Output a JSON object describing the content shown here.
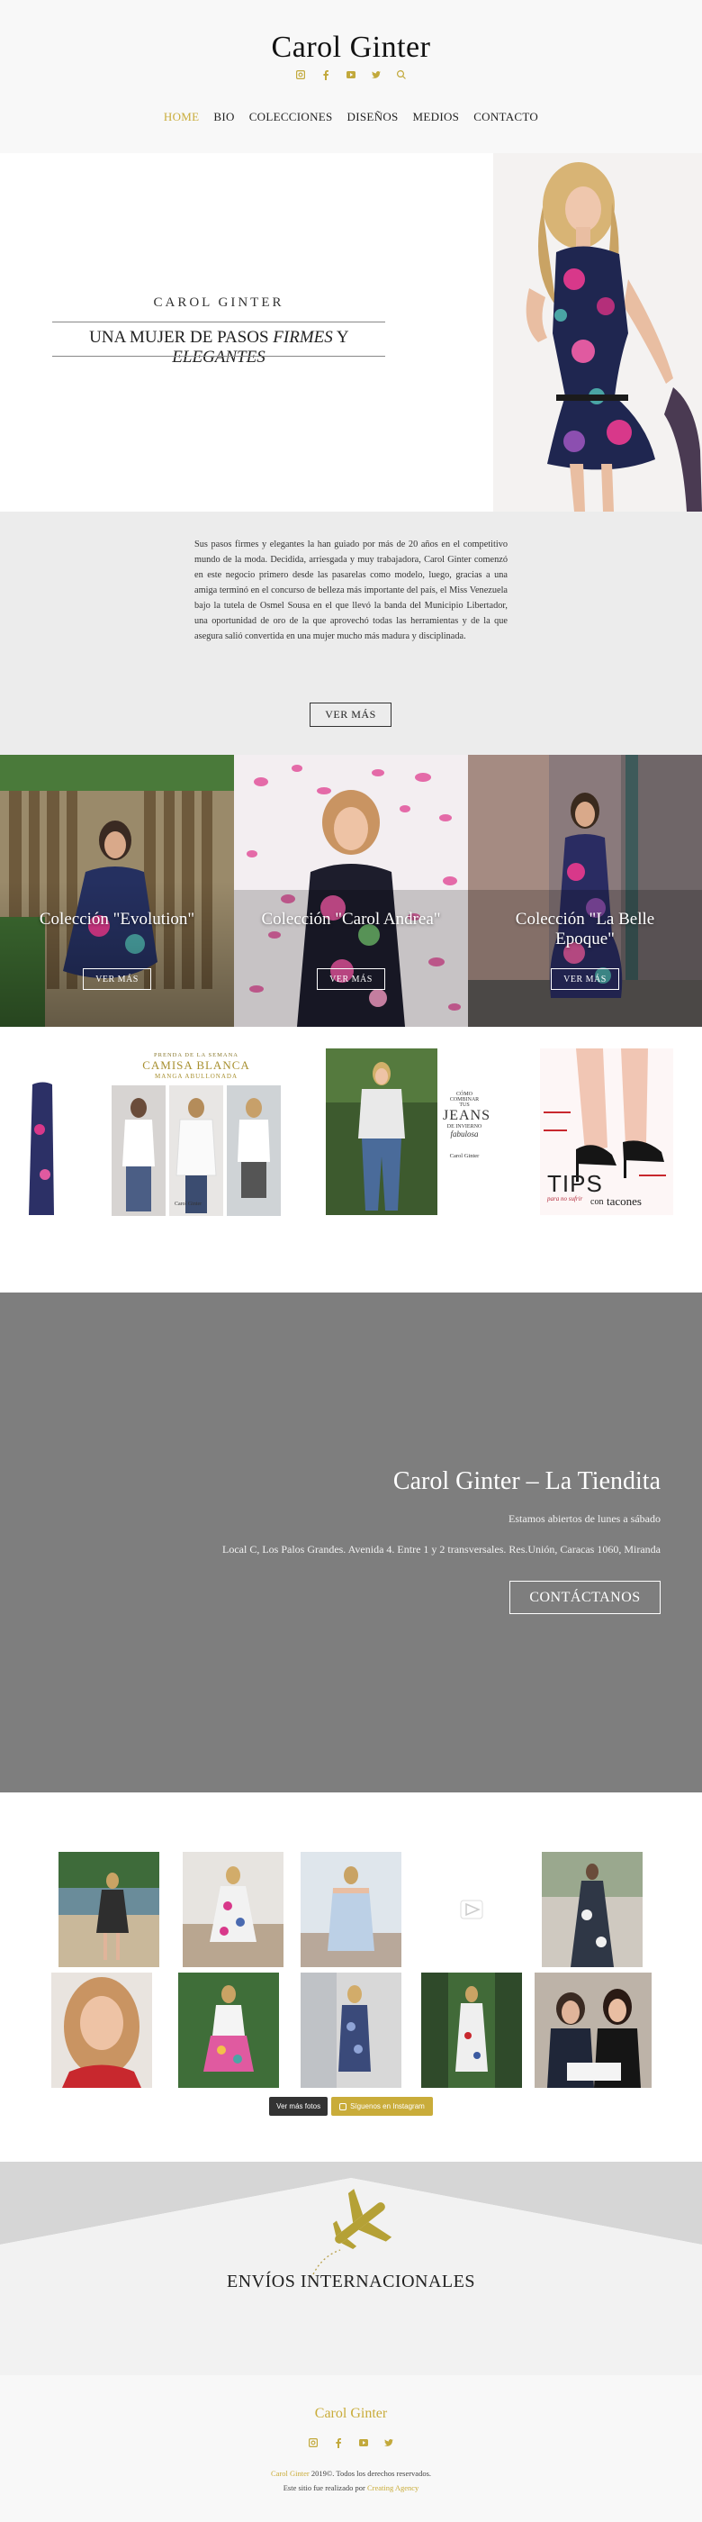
{
  "site": {
    "title": "Carol Ginter"
  },
  "social": [
    "instagram-icon",
    "facebook-icon",
    "youtube-icon",
    "twitter-icon",
    "search-icon"
  ],
  "nav": [
    {
      "label": "Home",
      "active": true
    },
    {
      "label": "Bio"
    },
    {
      "label": "Colecciones"
    },
    {
      "label": "Diseños"
    },
    {
      "label": "Medios"
    },
    {
      "label": "Contacto"
    }
  ],
  "hero": {
    "name": "CAROL GINTER",
    "tag_pre": "UNA MUJER DE PASOS ",
    "tag_i1": "FIRMES",
    "tag_mid": " Y ",
    "tag_i2": "ELEGANTES"
  },
  "intro": {
    "text": "Sus pasos firmes y elegantes la han guiado por más de 20 años en el competitivo mundo de la moda. Decidida, arriesgada y muy trabajadora, Carol Ginter comenzó en este negocio primero desde las pasarelas como modelo, luego, gracias a una amiga terminó en el concurso de belleza más importante del país, el Miss Venezuela bajo la tutela de Osmel Sousa en el que llevó la banda del Municipio Libertador, una oportunidad de oro de la que aprovechó todas las herramientas y de la que asegura salió convertida en una mujer mucho más madura y disciplinada.",
    "button": "VER MÁS"
  },
  "collections": [
    {
      "title": "Colección \"Evolution\"",
      "button": "VER MÁS"
    },
    {
      "title": "Colección \"Carol Andrea\"",
      "button": "VER MÁS"
    },
    {
      "title": "Colección \"La Belle Epoque\"",
      "button": "VER MÁS"
    }
  ],
  "carousel": {
    "camisa_small": "PRENDA DE LA SEMANA",
    "camisa_title": "CAMISA BLANCA",
    "camisa_sub": "MANGA ABULLONADA",
    "brand": "Carol Ginter",
    "jeans_l1": "CÓMO",
    "jeans_l2": "COMBINAR",
    "jeans_l3": "TUS",
    "jeans_l4": "JEANS",
    "jeans_l5": "DE INVIERNO",
    "jeans_l6": "fabulosa",
    "tips_word": "TIPS",
    "tips_sub": "para no sufrir",
    "tips_con": "con",
    "tips_tacones": "tacones"
  },
  "tiendita": {
    "title": "Carol Ginter – La Tiendita",
    "hours": "Estamos abiertos de lunes a sábado",
    "address": "Local C, Los Palos Grandes. Avenida 4. Entre 1 y 2 transversales. Res.Unión, Caracas 1060, Miranda",
    "button": "CONTÁCTANOS"
  },
  "instagram": {
    "more": "Ver más fotos",
    "follow": "Síguenos en Instagram"
  },
  "shipping": {
    "title": "ENVÍOS INTERNACIONALES"
  },
  "footer": {
    "title": "Carol Ginter",
    "copy_brand": "Carol Ginter",
    "copy_rest": " 2019©. Todos los derechos reservados.",
    "credit_pre": "Este sitio fue realizado por ",
    "credit_link": "Creating Agency"
  },
  "colors": {
    "accent": "#c9ac3a",
    "band_gray": "#7e7e7e",
    "light_gray": "#ececec"
  }
}
